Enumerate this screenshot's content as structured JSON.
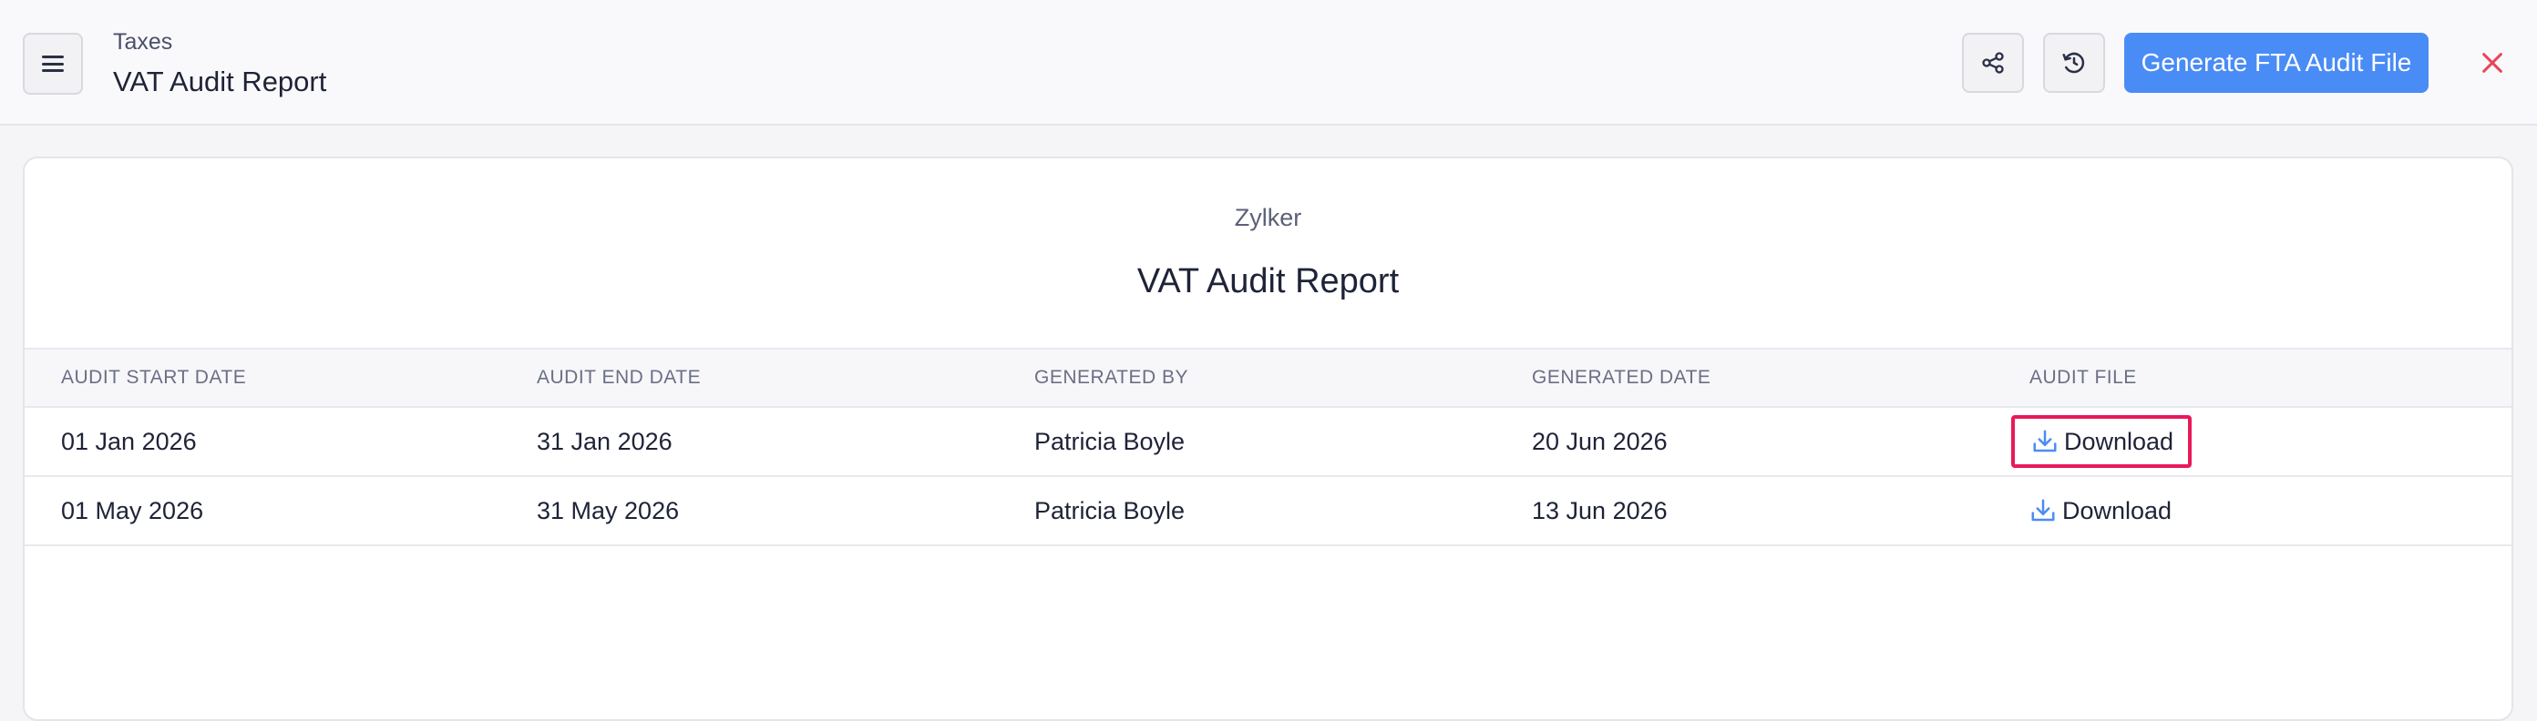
{
  "header": {
    "breadcrumb": "Taxes",
    "title": "VAT Audit Report",
    "generate_label": "Generate FTA Audit File",
    "icons": {
      "menu": "menu-icon",
      "share": "share-icon",
      "history": "history-icon",
      "close": "close-icon"
    }
  },
  "report": {
    "organization": "Zylker",
    "title": "VAT Audit Report",
    "columns": [
      "AUDIT START DATE",
      "AUDIT END DATE",
      "GENERATED BY",
      "GENERATED DATE",
      "AUDIT FILE"
    ],
    "rows": [
      {
        "start": "01 Jan 2026",
        "end": "31 Jan 2026",
        "generated_by": "Patricia Boyle",
        "generated_date": "20 Jun 2026",
        "file_label": "Download"
      },
      {
        "start": "01 May 2026",
        "end": "31 May 2026",
        "generated_by": "Patricia Boyle",
        "generated_date": "13 Jun 2026",
        "file_label": "Download"
      }
    ]
  },
  "colors": {
    "accent": "#4a8cf6",
    "highlight": "#e8195a",
    "close": "#e8455a"
  }
}
